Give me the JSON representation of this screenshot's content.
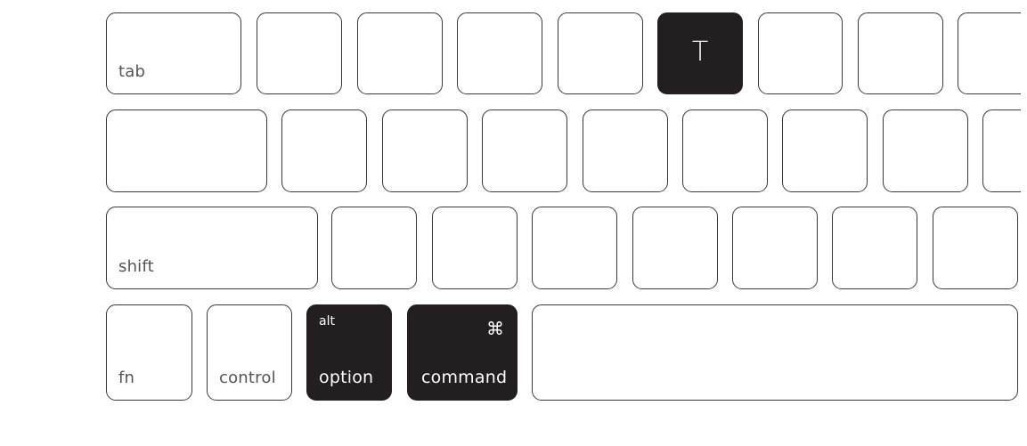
{
  "keys": {
    "tab": "tab",
    "t": "T",
    "shift": "shift",
    "fn": "fn",
    "control": "control",
    "option": "option",
    "option_alt": "alt",
    "command": "command",
    "command_symbol": "⌘"
  },
  "highlighted_keys": [
    "T",
    "option",
    "command"
  ],
  "colors": {
    "highlight": "#231f20",
    "key_border": "#3a3a3a"
  }
}
